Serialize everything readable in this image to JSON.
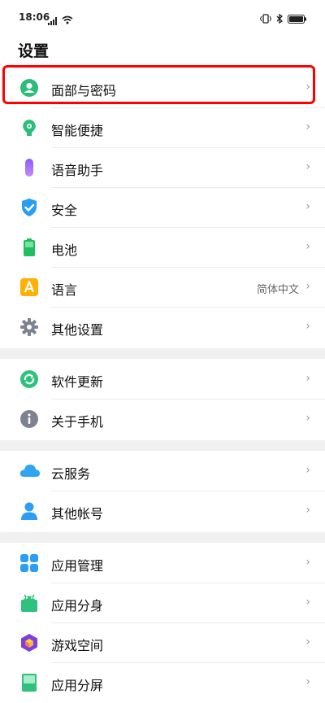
{
  "status_bar": {
    "time": "18:06"
  },
  "title": "设置",
  "groups": [
    [
      {
        "label": "面部与密码",
        "value": "",
        "icon": "face-user-icon"
      },
      {
        "label": "智能便捷",
        "value": "",
        "icon": "smart-bulb-icon"
      },
      {
        "label": "语音助手",
        "value": "",
        "icon": "mic-icon"
      },
      {
        "label": "安全",
        "value": "",
        "icon": "shield-icon"
      },
      {
        "label": "电池",
        "value": "",
        "icon": "battery-icon"
      },
      {
        "label": "语言",
        "value": "简体中文",
        "icon": "language-icon"
      },
      {
        "label": "其他设置",
        "value": "",
        "icon": "gear-icon"
      }
    ],
    [
      {
        "label": "软件更新",
        "value": "",
        "icon": "update-icon"
      },
      {
        "label": "关于手机",
        "value": "",
        "icon": "info-icon"
      }
    ],
    [
      {
        "label": "云服务",
        "value": "",
        "icon": "cloud-icon"
      },
      {
        "label": "其他帐号",
        "value": "",
        "icon": "account-icon"
      }
    ],
    [
      {
        "label": "应用管理",
        "value": "",
        "icon": "apps-icon"
      },
      {
        "label": "应用分身",
        "value": "",
        "icon": "android-icon"
      },
      {
        "label": "游戏空间",
        "value": "",
        "icon": "game-cube-icon"
      },
      {
        "label": "应用分屏",
        "value": "",
        "icon": "split-screen-icon"
      }
    ]
  ],
  "chevron": "›"
}
